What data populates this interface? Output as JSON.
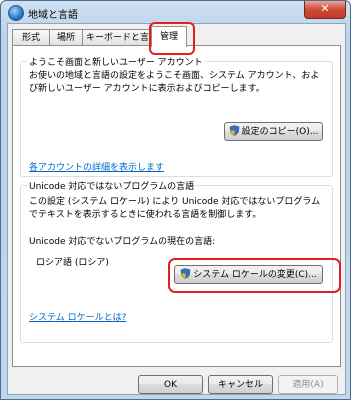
{
  "window": {
    "title": "地域と言語",
    "close_glyph": "✕"
  },
  "tabs": [
    {
      "label": "形式"
    },
    {
      "label": "場所"
    },
    {
      "label": "キーボードと言語"
    },
    {
      "label": "管理"
    }
  ],
  "welcome_group": {
    "title": "ようこそ画面と新しいユーザー アカウント",
    "description": "お使いの地域と言語の設定をようこそ画面、システム アカウント、および新しいユーザー アカウントに表示およびコピーします。",
    "copy_button": "設定のコピー(O)...",
    "details_link": "各アカウントの詳細を表示します"
  },
  "unicode_group": {
    "title": "Unicode 対応ではないプログラムの言語",
    "description": "この設定 (システム ロケール) により Unicode 対応ではないプログラムでテキストを表示するときに使われる言語を制御します。",
    "current_label": "Unicode 対応でないプログラムの現在の言語:",
    "current_value": "ロシア語 (ロシア)",
    "change_button": "システム ロケールの変更(C)...",
    "what_link": "システム ロケールとは?"
  },
  "footer": {
    "ok": "OK",
    "cancel": "キャンセル",
    "apply": "適用(A)"
  },
  "colors": {
    "highlight": "#e02020",
    "link": "#0066cc"
  }
}
